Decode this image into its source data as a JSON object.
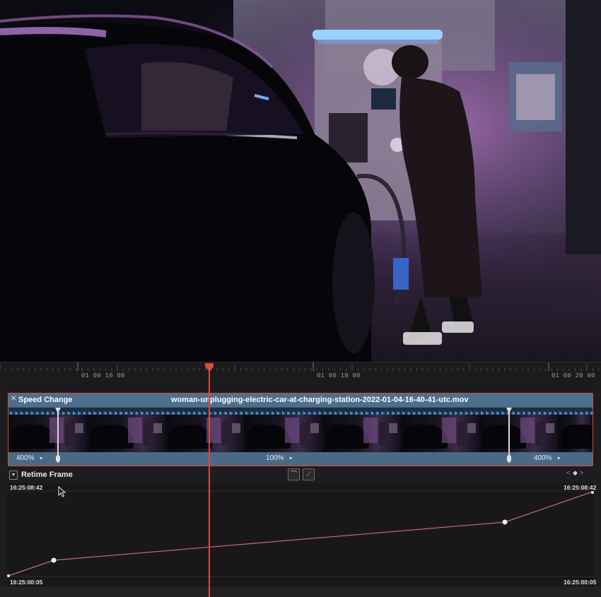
{
  "viewer": {
    "description_icon": "video-frame"
  },
  "ruler": {
    "timecodes": [
      "01 00 16 00",
      "01 00 18 00",
      "01 00 20 00"
    ]
  },
  "clip": {
    "effect_label": "Speed Change",
    "file_name": "woman-unplugging-electric-car-at-charging-station-2022-01-04-16-40-41-utc.mov",
    "segments": [
      {
        "speed": "400%"
      },
      {
        "speed": "100%"
      },
      {
        "speed": "400%"
      }
    ]
  },
  "retime": {
    "label": "Retime Frame",
    "top_left_tc": "16:25:08:42",
    "top_right_tc": "16:25:08:42",
    "bottom_left_tc": "16:25:00:05",
    "bottom_right_tc": "16:25:00:05",
    "nav": {
      "prev": "<",
      "diamond": "◆",
      "next": ">"
    }
  },
  "colors": {
    "accent_red": "#e0483a",
    "clip_blue": "#4d6f8d",
    "curve": "#c96b6b"
  }
}
